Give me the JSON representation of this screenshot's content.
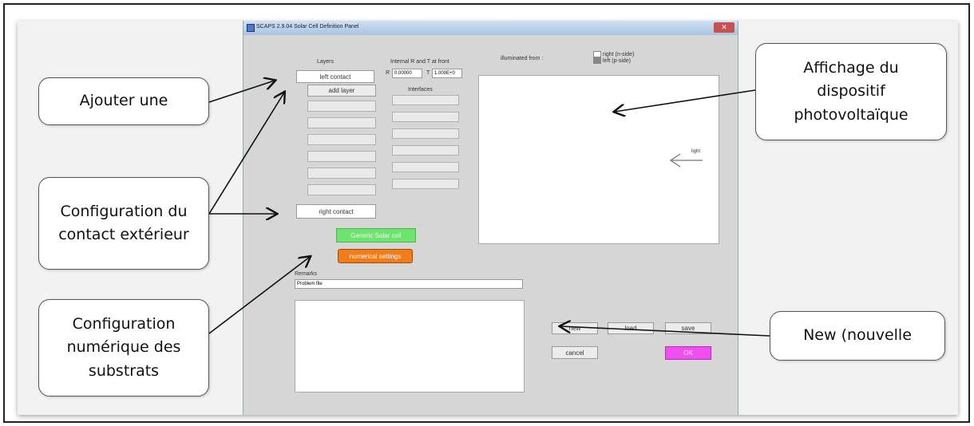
{
  "window": {
    "title": "SCAPS 2.9.04 Solar Cell Definition Panel"
  },
  "layers": {
    "header": "Layers",
    "left_contact": "left contact",
    "add_layer": "add layer",
    "right_contact": "right contact"
  },
  "internal": {
    "header": "Internal R and T at front",
    "r_label": "R",
    "r_value": "0.00000",
    "t_label": "T",
    "t_value": "1.000E+0",
    "interfaces_header": "Interfaces"
  },
  "display": {
    "illuminated_label": "illuminated from :",
    "right_option": "right (n-side)",
    "left_option": "left (p-side)",
    "light_label": "light"
  },
  "buttons": {
    "generic": "Generic Solar cell",
    "numerical": "numerical settings",
    "new": "new",
    "load": "load",
    "save": "save",
    "cancel": "cancel",
    "ok": "OK"
  },
  "remarks": {
    "label": "Remarks",
    "value": "Problem file"
  },
  "annotations": {
    "add": "Ajouter une",
    "contact": "Configuration du contact extérieur",
    "numeric": "Configuration numérique des substrats",
    "display": "Affichage du dispositif photovoltaïque",
    "new": "New (nouvelle"
  },
  "colors": {
    "generic_btn": "#6fe36f",
    "numerical_btn": "#f07c1a",
    "ok_btn": "#f04ef0"
  }
}
